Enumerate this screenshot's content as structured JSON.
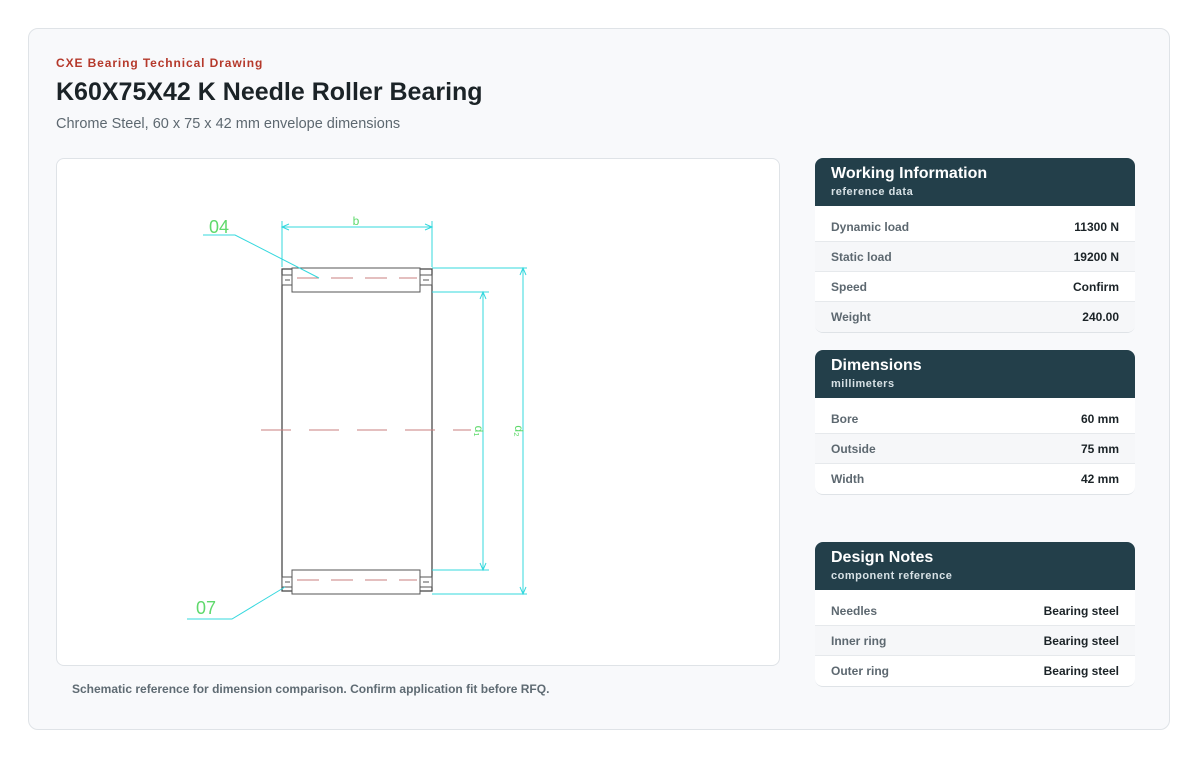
{
  "header": {
    "brand": "CXE Bearing Technical Drawing",
    "title": "K60X75X42 K Needle Roller Bearing",
    "subtitle": "Chrome Steel, 60 x 75 x 42 mm envelope dimensions"
  },
  "drawing": {
    "labels": {
      "b": "b",
      "d1": "d₁",
      "d2": "d₂",
      "top_callout": "04",
      "bottom_callout": "07"
    },
    "colors": {
      "dimension": "#35d8de",
      "callout": "#5fd96c",
      "outline": "#3b3b3b",
      "centerline": "#c97f7f"
    }
  },
  "caption": "Schematic reference for dimension comparison. Confirm application fit before RFQ.",
  "panels": {
    "working": {
      "title": "Working Information",
      "subtitle": "reference data",
      "rows": [
        {
          "label": "Dynamic load",
          "value": "11300 N"
        },
        {
          "label": "Static load",
          "value": "19200 N"
        },
        {
          "label": "Speed",
          "value": "Confirm"
        },
        {
          "label": "Weight",
          "value": "240.00"
        }
      ]
    },
    "dimensions": {
      "title": "Dimensions",
      "subtitle": "millimeters",
      "rows": [
        {
          "label": "Bore",
          "value": "60 mm"
        },
        {
          "label": "Outside",
          "value": "75 mm"
        },
        {
          "label": "Width",
          "value": "42 mm"
        }
      ]
    },
    "notes": {
      "title": "Design Notes",
      "subtitle": "component reference",
      "rows": [
        {
          "label": "Needles",
          "value": "Bearing steel"
        },
        {
          "label": "Inner ring",
          "value": "Bearing steel"
        },
        {
          "label": "Outer ring",
          "value": "Bearing steel"
        }
      ]
    }
  }
}
